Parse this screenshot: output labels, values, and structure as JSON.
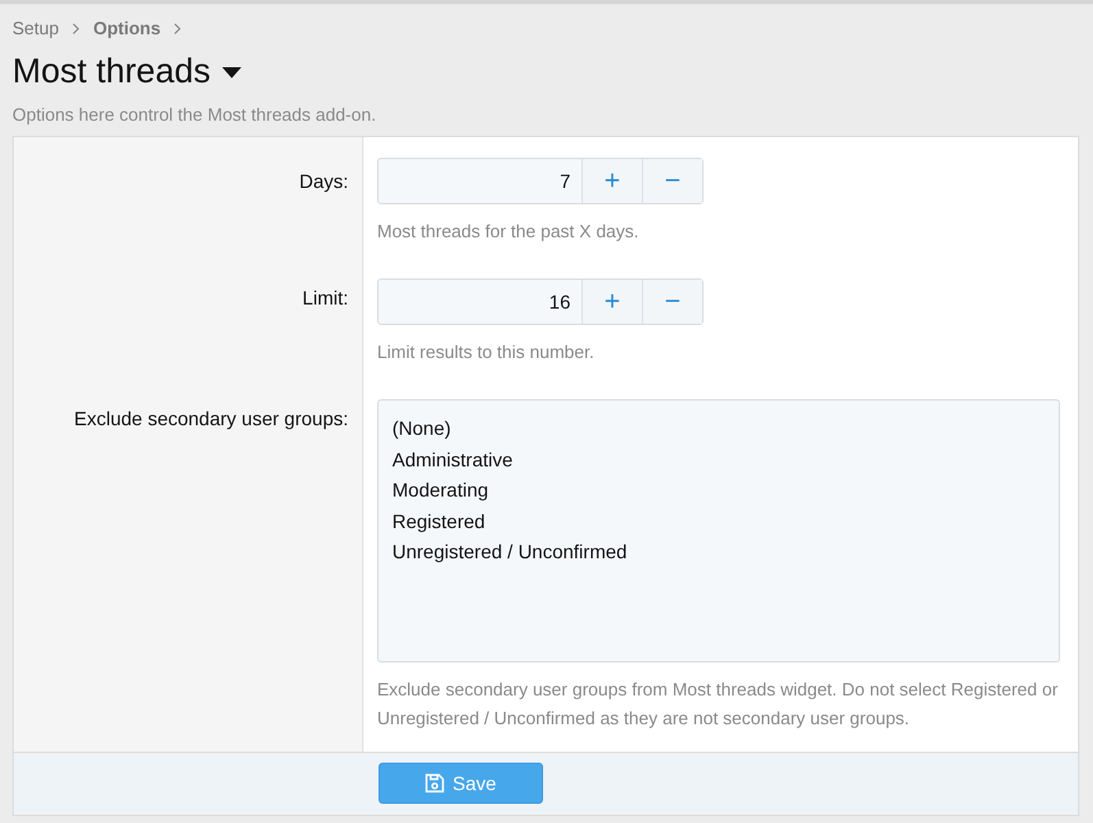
{
  "breadcrumbs": [
    {
      "label": "Setup",
      "current": false
    },
    {
      "label": "Options",
      "current": true
    }
  ],
  "page": {
    "title": "Most threads",
    "description": "Options here control the Most threads add-on."
  },
  "rows": [
    {
      "kind": "spinner",
      "label": "Days:",
      "value": "7",
      "increment": "+",
      "decrement": "−",
      "hint": "Most threads for the past X days."
    },
    {
      "kind": "spinner",
      "label": "Limit:",
      "value": "16",
      "increment": "+",
      "decrement": "−",
      "hint": "Limit results to this number."
    },
    {
      "kind": "multiselect",
      "label": "Exclude secondary user groups:",
      "options": [
        {
          "label": "(None)",
          "selected": false
        },
        {
          "label": "Administrative",
          "selected": false
        },
        {
          "label": "Moderating",
          "selected": false
        },
        {
          "label": "Registered",
          "selected": false
        },
        {
          "label": "Unregistered / Unconfirmed",
          "selected": false
        }
      ],
      "hint": "Exclude secondary user groups from Most threads widget. Do not select Registered or Unregistered / Unconfirmed as they are not secondary user groups."
    }
  ],
  "footer": {
    "button": "Save"
  }
}
